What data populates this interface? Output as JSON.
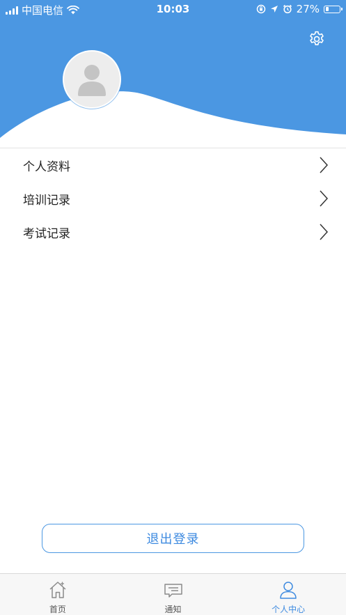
{
  "status_bar": {
    "carrier": "中国电信",
    "time": "10:03",
    "battery_percent": "27%",
    "battery_level": 0.27
  },
  "header": {
    "background_color": "#4b97e2",
    "settings_icon": "gear-icon",
    "avatar_icon": "user-placeholder-icon"
  },
  "menu": {
    "items": [
      {
        "label": "个人资料"
      },
      {
        "label": "培训记录"
      },
      {
        "label": "考试记录"
      }
    ]
  },
  "logout": {
    "label": "退出登录"
  },
  "tabbar": {
    "tabs": [
      {
        "label": "首页",
        "icon": "home-icon",
        "active": false
      },
      {
        "label": "通知",
        "icon": "message-icon",
        "active": false
      },
      {
        "label": "个人中心",
        "icon": "user-icon",
        "active": true
      }
    ],
    "active_color": "#3d8ae0"
  }
}
